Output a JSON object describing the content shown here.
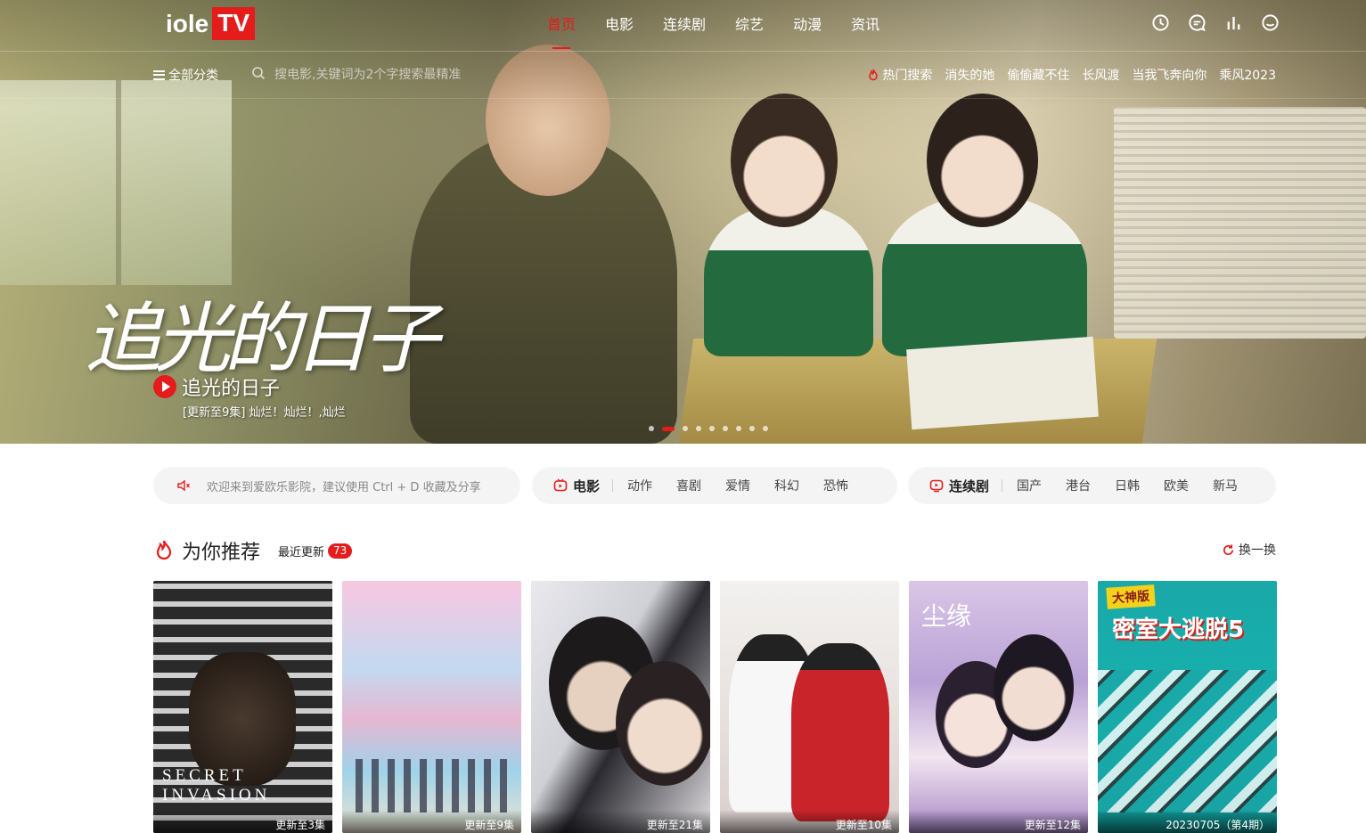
{
  "header": {
    "logo_text": "iole",
    "logo_badge": "TV",
    "nav": [
      {
        "label": "首页",
        "active": true
      },
      {
        "label": "电影",
        "active": false
      },
      {
        "label": "连续剧",
        "active": false
      },
      {
        "label": "综艺",
        "active": false
      },
      {
        "label": "动漫",
        "active": false
      },
      {
        "label": "资讯",
        "active": false
      }
    ],
    "icons": [
      "clock-icon",
      "message-icon",
      "chart-icon",
      "smile-icon"
    ]
  },
  "subnav": {
    "category_label": "全部分类",
    "search_placeholder": "搜电影,关键词为2个字搜索最精准",
    "hot_label": "热门搜索",
    "hot_items": [
      "消失的她",
      "偷偷藏不住",
      "长风渡",
      "当我飞奔向你",
      "乘风2023"
    ]
  },
  "hero": {
    "calligraphy": "追光的日子",
    "title": "追光的日子",
    "subtitle": "[更新至9集] 灿烂！灿烂！,灿烂",
    "slide_count": 9,
    "active_slide": 1
  },
  "categories": {
    "notice": "欢迎来到爱欧乐影院，建议使用 Ctrl + D 收藏及分享",
    "movies": {
      "label": "电影",
      "items": [
        "动作",
        "喜剧",
        "爱情",
        "科幻",
        "恐怖"
      ]
    },
    "series": {
      "label": "连续剧",
      "items": [
        "国产",
        "港台",
        "日韩",
        "欧美",
        "新马"
      ]
    }
  },
  "recommend": {
    "title": "为你推荐",
    "recent_label": "最近更新",
    "recent_count": "73",
    "refresh_label": "换一换",
    "cards": [
      {
        "caption": "更新至3集",
        "poster_text": "SECRET INVASION"
      },
      {
        "caption": "更新至9集",
        "poster_text": ""
      },
      {
        "caption": "更新至21集",
        "poster_text": ""
      },
      {
        "caption": "更新至10集",
        "poster_text": ""
      },
      {
        "caption": "更新至12集",
        "poster_text": "尘缘"
      },
      {
        "caption": "20230705（第4期）",
        "poster_text": "密室大逃脱5",
        "poster_tag": "大神版"
      }
    ]
  },
  "colors": {
    "accent": "#e41c1c"
  }
}
